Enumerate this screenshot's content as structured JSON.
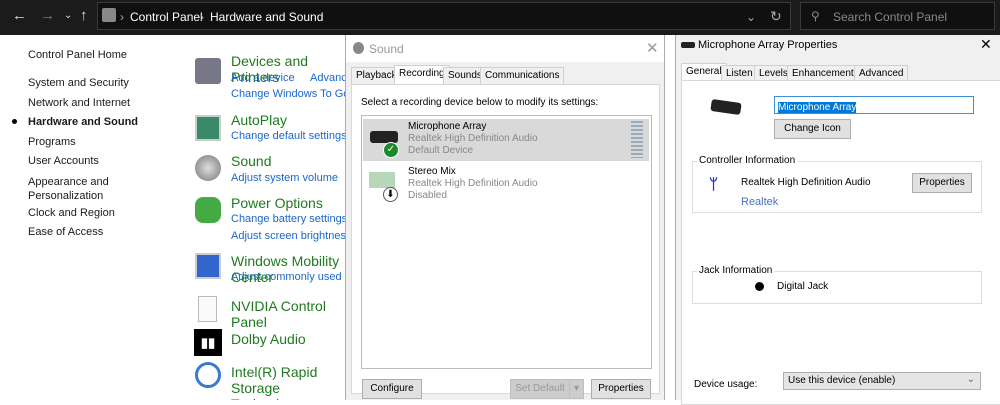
{
  "explorer": {
    "breadcrumb": [
      "Control Panel",
      "Hardware and Sound"
    ],
    "search_placeholder": "Search Control Panel",
    "sidebar": [
      "Control Panel Home",
      "System and Security",
      "Network and Internet",
      "Hardware and Sound",
      "Programs",
      "User Accounts",
      "Appearance and Personalization",
      "Clock and Region",
      "Ease of Access"
    ],
    "selected_sidebar": "Hardware and Sound",
    "categories": [
      {
        "title": "Devices and Printers",
        "links": [
          "Add a device",
          "Advanced printer setup",
          "Change Windows To Go startup options"
        ]
      },
      {
        "title": "AutoPlay",
        "links": [
          "Change default settings for media or devices"
        ]
      },
      {
        "title": "Sound",
        "links": [
          "Adjust system volume"
        ]
      },
      {
        "title": "Power Options",
        "links": [
          "Change battery settings",
          "Adjust screen brightness"
        ]
      },
      {
        "title": "Windows Mobility Center",
        "links": [
          "Adjust commonly used mobility settings"
        ]
      },
      {
        "title": "NVIDIA Control Panel",
        "links": []
      },
      {
        "title": "Dolby Audio",
        "links": []
      },
      {
        "title": "Intel(R) Rapid Storage Technology",
        "links": []
      }
    ]
  },
  "sound_dialog": {
    "title": "Sound",
    "tabs": [
      "Playback",
      "Recording",
      "Sounds",
      "Communications"
    ],
    "active_tab": "Recording",
    "instruction": "Select a recording device below to modify its settings:",
    "devices": [
      {
        "name": "Microphone Array",
        "driver": "Realtek High Definition Audio",
        "status": "Default Device"
      },
      {
        "name": "Stereo Mix",
        "driver": "Realtek High Definition Audio",
        "status": "Disabled"
      }
    ],
    "buttons": {
      "configure": "Configure",
      "set_default": "Set Default",
      "properties": "Properties"
    }
  },
  "props_dialog": {
    "title": "Microphone Array Properties",
    "tabs": [
      "General",
      "Listen",
      "Levels",
      "Enhancements",
      "Advanced"
    ],
    "active_tab": "General",
    "name_value": "Microphone Array",
    "change_icon": "Change Icon",
    "controller_label": "Controller Information",
    "controller_name": "Realtek High Definition Audio",
    "controller_vendor": "Realtek",
    "controller_properties": "Properties",
    "jack_label": "Jack Information",
    "jack_name": "Digital Jack",
    "usage_label": "Device usage:",
    "usage_value": "Use this device (enable)"
  }
}
